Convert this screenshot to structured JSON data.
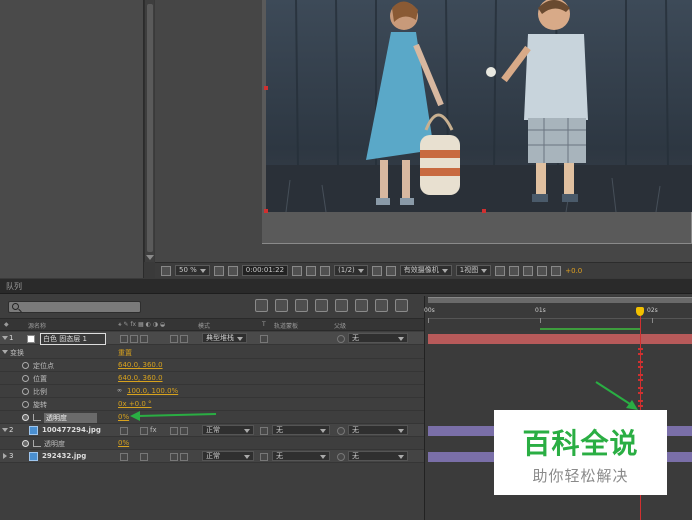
{
  "viewer": {
    "zoom": "50 %",
    "timecode": "0:00:01:22",
    "resolution": "(1/2)",
    "camera": "有效摄像机",
    "views": "1视图",
    "exposure": "+0.0"
  },
  "timeline": {
    "tab_label": "队列",
    "search_placeholder": "",
    "columns": {
      "layer_name": "源名称",
      "switches": "模式",
      "t": "T",
      "track_matte": "轨道蒙板",
      "parent": "父级"
    },
    "ruler_labels": [
      "00s",
      "01s",
      "02s"
    ],
    "layers": [
      {
        "index": "1",
        "name": "白色 固态层 1",
        "swatch_color": "#ffffff",
        "mode": "典型堆栈",
        "parent": "无",
        "transform_label": "变换",
        "reset_label": "重置",
        "properties": [
          {
            "label": "定位点",
            "value": "640.0, 360.0"
          },
          {
            "label": "位置",
            "value": "640.0, 360.0"
          },
          {
            "label": "比例",
            "value": "100.0, 100.0%"
          },
          {
            "label": "旋转",
            "value": "0x +0.0 °"
          },
          {
            "label": "透明度",
            "value": "0%"
          }
        ],
        "bar_color": "#b85a5a"
      },
      {
        "index": "2",
        "name": "100477294.jpg",
        "mode": "正常",
        "track_matte": "无",
        "parent": "无",
        "opacity_label": "透明度",
        "opacity_value": "0%",
        "bar_color": "#7a6fa8"
      },
      {
        "index": "3",
        "name": "292432.jpg",
        "mode": "正常",
        "track_matte": "无",
        "parent": "无",
        "bar_color": "#7a6fa8"
      }
    ]
  },
  "colors": {
    "accent_orange": "#d7a21e",
    "annotation_green": "#2aae43",
    "playhead_red": "#d03030"
  },
  "watermark": {
    "title": "百科全说",
    "subtitle": "助你轻松解决"
  }
}
